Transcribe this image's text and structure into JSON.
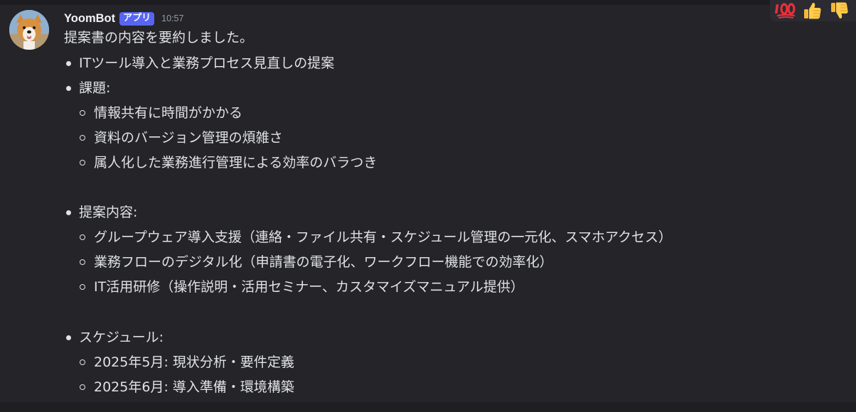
{
  "message": {
    "author": "YoomBot",
    "badge": "アプリ",
    "timestamp": "10:57",
    "intro": "提案書の内容を要約しました。",
    "topic": "ITツール導入と業務プロセス見直しの提案",
    "issues": {
      "label": "課題:",
      "items": [
        "情報共有に時間がかかる",
        "資料のバージョン管理の煩雑さ",
        "属人化した業務進行管理による効率のバラつき"
      ]
    },
    "proposal": {
      "label": "提案内容:",
      "items": [
        "グループウェア導入支援（連絡・ファイル共有・スケジュール管理の一元化、スマホアクセス）",
        "業務フローのデジタル化（申請書の電子化、ワークフロー機能での効率化）",
        "IT活用研修（操作説明・活用セミナー、カスタマイズマニュアル提供）"
      ]
    },
    "schedule": {
      "label": "スケジュール:",
      "items": [
        "2025年5月: 現状分析・要件定義",
        "2025年6月: 導入準備・環境構築"
      ]
    }
  },
  "reactions": [
    {
      "icon": "hundred-points-icon"
    },
    {
      "icon": "thumbs-up-icon"
    },
    {
      "icon": "thumbs-down-icon"
    }
  ]
}
